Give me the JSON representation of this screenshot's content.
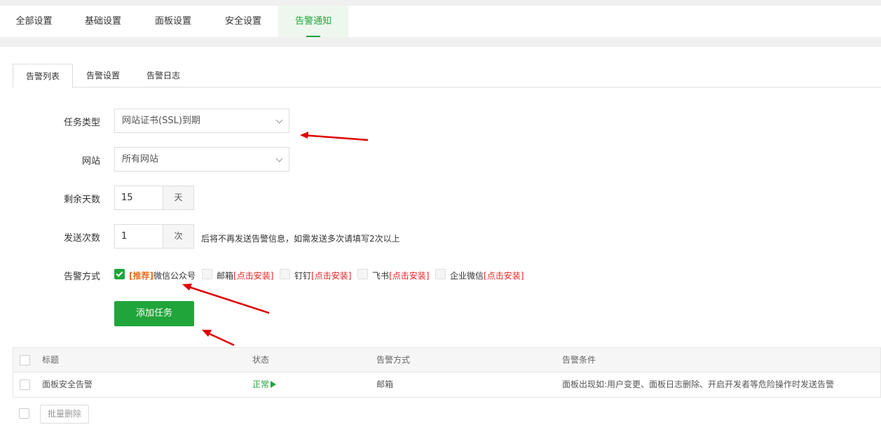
{
  "top_tabs": [
    {
      "label": "全部设置",
      "active": false
    },
    {
      "label": "基础设置",
      "active": false
    },
    {
      "label": "面板设置",
      "active": false
    },
    {
      "label": "安全设置",
      "active": false
    },
    {
      "label": "告警通知",
      "active": true
    }
  ],
  "sub_tabs": [
    {
      "label": "告警列表",
      "active": true
    },
    {
      "label": "告警设置",
      "active": false
    },
    {
      "label": "告警日志",
      "active": false
    }
  ],
  "form": {
    "task_type": {
      "label": "任务类型",
      "value": "网站证书(SSL)到期"
    },
    "site": {
      "label": "网站",
      "value": "所有网站"
    },
    "remaining_days": {
      "label": "剩余天数",
      "value": "15",
      "unit": "天"
    },
    "send_count": {
      "label": "发送次数",
      "value": "1",
      "unit": "次",
      "hint": "后将不再发送告警信息，如需发送多次请填写2次以上"
    },
    "alert_method": {
      "label": "告警方式",
      "options": [
        {
          "prefix": "[推荐]",
          "name": "微信公众号",
          "suffix": "",
          "checked": true
        },
        {
          "prefix": "",
          "name": "邮箱",
          "suffix": "[点击安装]",
          "checked": false
        },
        {
          "prefix": "",
          "name": "钉钉",
          "suffix": "[点击安装]",
          "checked": false
        },
        {
          "prefix": "",
          "name": "飞书",
          "suffix": "[点击安装]",
          "checked": false
        },
        {
          "prefix": "",
          "name": "企业微信",
          "suffix": "[点击安装]",
          "checked": false
        }
      ]
    },
    "submit_label": "添加任务"
  },
  "table": {
    "headers": [
      "标题",
      "状态",
      "告警方式",
      "告警条件"
    ],
    "rows": [
      {
        "title": "面板安全告警",
        "status": "正常",
        "method": "邮箱",
        "condition": "面板出现如:用户变更、面板日志删除、开启开发者等危险操作时发送告警"
      }
    ]
  },
  "bulk_delete_label": "批量删除",
  "colors": {
    "accent": "#20a53a",
    "annotation_arrow": "#e00000",
    "recommend": "#e96f1e",
    "install_link": "#e22222"
  }
}
